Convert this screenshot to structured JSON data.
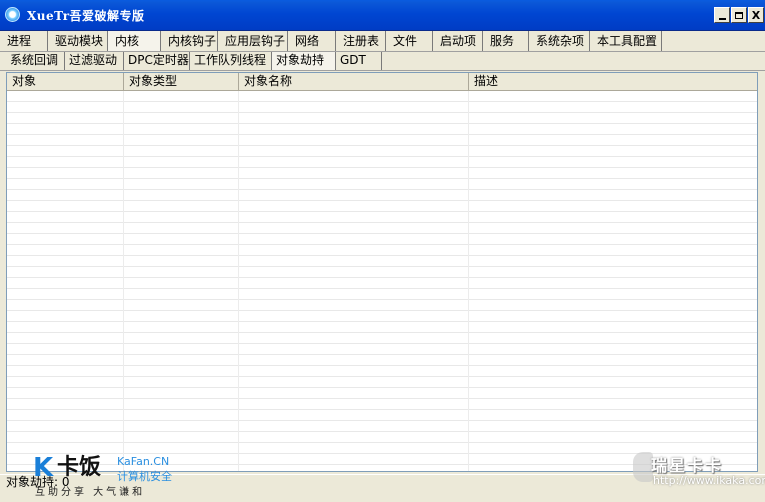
{
  "window": {
    "title": "XueTr吾爱破解专版",
    "minimize_label": "",
    "maximize_label": "",
    "close_label": "X"
  },
  "main_tabs": [
    "进程",
    "驱动模块",
    "内核",
    "内核钩子",
    "应用层钩子",
    "网络",
    "注册表",
    "文件",
    "启动项",
    "服务",
    "系统杂项",
    "本工具配置"
  ],
  "main_active": "内核",
  "sub_tabs": [
    "系统回调",
    "过滤驱动",
    "DPC定时器",
    "工作队列线程",
    "对象劫持",
    "GDT"
  ],
  "sub_active": "对象劫持",
  "list": {
    "columns": [
      "对象",
      "对象类型",
      "对象名称",
      "描述"
    ],
    "rows": []
  },
  "status": {
    "text": "对象劫持: 0"
  },
  "watermarks": {
    "left": {
      "logo_k": "K",
      "logo_text": "卡饭",
      "en": "KaFan.CN",
      "cn": "计算机安全",
      "slogan": "互助分享  大气谦和"
    },
    "right": {
      "brand": "瑞星卡卡",
      "url": "http://www.ikaka.com"
    }
  },
  "colors": {
    "titlebar": "#0046d2",
    "window_bg": "#ece9d8",
    "list_bg": "#ffffff",
    "kafan_blue": "#1a7fd8"
  }
}
